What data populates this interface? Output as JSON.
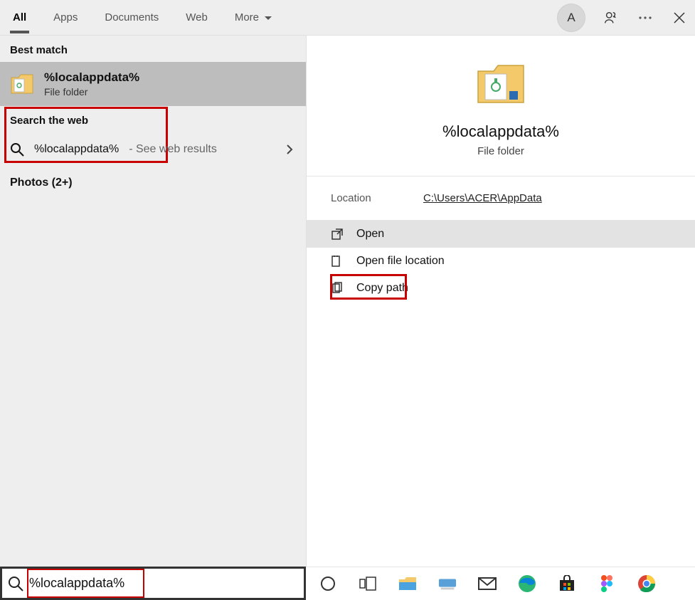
{
  "tabs": {
    "all": "All",
    "apps": "Apps",
    "documents": "Documents",
    "web": "Web",
    "more": "More"
  },
  "avatar_initial": "A",
  "left": {
    "best_match_label": "Best match",
    "best_match_title": "%localappdata%",
    "best_match_subtitle": "File folder",
    "search_web_label": "Search the web",
    "web_query": "%localappdata%",
    "web_suffix": " - See web results",
    "photos_label": "Photos (2+)"
  },
  "preview": {
    "title": "%localappdata%",
    "subtitle": "File folder",
    "location_label": "Location",
    "location_path": "C:\\Users\\ACER\\AppData",
    "actions": {
      "open": "Open",
      "open_location": "Open file location",
      "copy_path": "Copy path"
    }
  },
  "search": {
    "value": "%localappdata%"
  },
  "taskbar_icons": [
    "cortana",
    "task-view",
    "file-explorer",
    "keyboard",
    "mail",
    "edge",
    "store",
    "figma",
    "chrome"
  ]
}
